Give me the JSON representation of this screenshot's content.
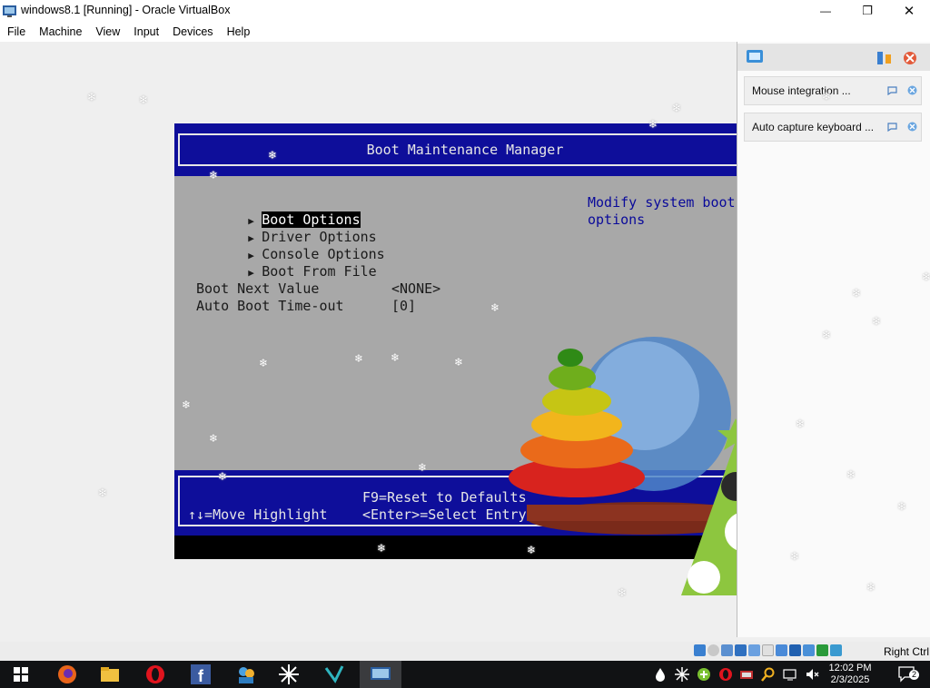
{
  "window": {
    "title": "windows8.1 [Running] - Oracle VirtualBox",
    "minimize_glyph": "—",
    "maximize_glyph": "❐",
    "close_glyph": "✕"
  },
  "menu": [
    "File",
    "Machine",
    "View",
    "Input",
    "Devices",
    "Help"
  ],
  "bios": {
    "title": "Boot Maintenance Manager",
    "menu_items": [
      "Boot Options",
      "Driver Options",
      "Console Options",
      "Boot From File"
    ],
    "selected_index": 0,
    "fields": [
      {
        "label": "Boot Next Value",
        "value": "<NONE>"
      },
      {
        "label": "Auto Boot Time-out",
        "value": "[0]"
      }
    ],
    "help_text": "Modify system boot options",
    "footer": {
      "move": "↑↓=Move Highlight",
      "reset": "F9=Reset to Defaults",
      "select": "<Enter>=Select Entry"
    }
  },
  "notifications": [
    {
      "label": "Mouse integration ..."
    },
    {
      "label": "Auto capture keyboard ..."
    }
  ],
  "statusbar": {
    "host_key": "Right Ctrl"
  },
  "taskbar": {
    "time": "12:02 PM",
    "date": "2/3/2025",
    "notification_count": "2"
  },
  "colors": {
    "bios_blue": "#0e0e9a",
    "bios_gray": "#a8a8a8",
    "help_blue": "#0a0a9a",
    "taskbar": "#111214"
  }
}
